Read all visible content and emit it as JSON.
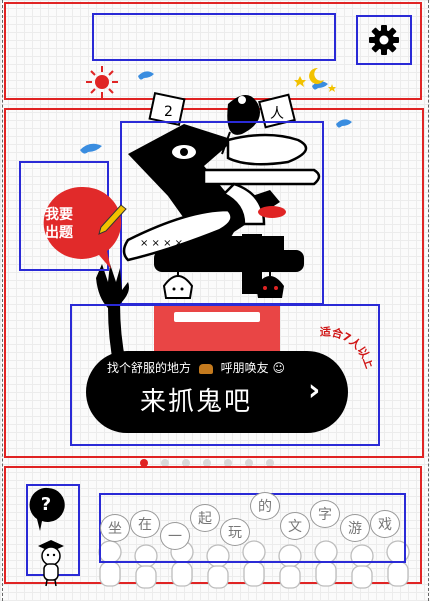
{
  "header": {
    "title": "",
    "settings_icon": "gear-icon"
  },
  "logo": {
    "tag_left": "2",
    "tag_right": "人"
  },
  "create_button": {
    "label_line1": "我要",
    "label_line2": "出题",
    "color": "#e12a2a"
  },
  "start_button": {
    "subtitle_part1": "找个舒服的地方",
    "subtitle_part2": "呼朋唤友",
    "label": "来抓鬼吧",
    "arrow": "›"
  },
  "age_note": "适合7人以上",
  "carousel": {
    "count": 7,
    "active_index": 0
  },
  "help": {
    "label": "?"
  },
  "slogan": {
    "chars": [
      "坐",
      "在",
      "一",
      "起",
      "玩",
      "的",
      "文",
      "字",
      "游",
      "戏"
    ]
  },
  "colors": {
    "frame_red": "#e02424",
    "frame_blue": "#2a2ad6",
    "accent_red": "#e12a2a",
    "accent_blue": "#3a8de0"
  }
}
